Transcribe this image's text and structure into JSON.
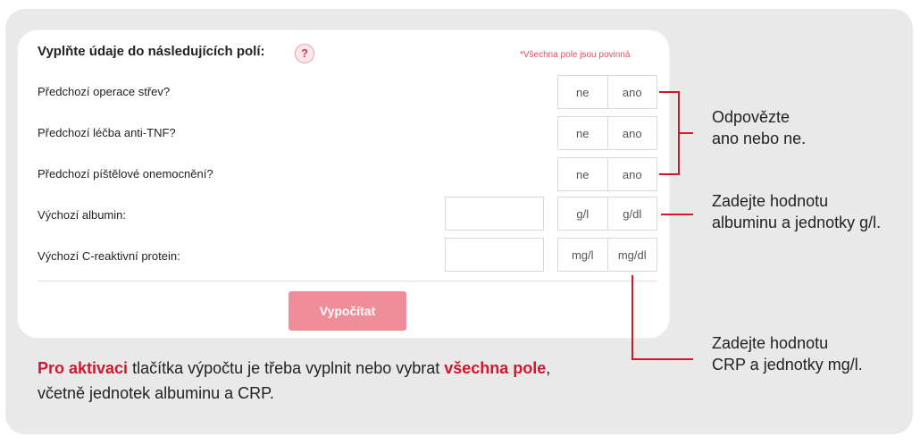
{
  "form": {
    "title": "Vyplňte údaje do následujících polí:",
    "help_glyph": "?",
    "required_note": "*Všechna pole jsou povinná",
    "rows": [
      {
        "label": "Předchozí operace střev?",
        "options": [
          "ne",
          "ano"
        ]
      },
      {
        "label": "Předchozí léčba anti-TNF?",
        "options": [
          "ne",
          "ano"
        ]
      },
      {
        "label": "Předchozí píštělové onemocnění?",
        "options": [
          "ne",
          "ano"
        ]
      },
      {
        "label": "Výchozí albumin:",
        "options": [
          "g/l",
          "g/dl"
        ],
        "value": ""
      },
      {
        "label": "Výchozí C-reaktivní protein:",
        "options": [
          "mg/l",
          "mg/dl"
        ],
        "value": ""
      }
    ],
    "calculate_label": "Vypočítat"
  },
  "annotations": {
    "yes_no_line1": "Odpovězte",
    "yes_no_line2": "ano nebo ne.",
    "albumin_line1": "Zadejte hodnotu",
    "albumin_line2": "albuminu a jednotky g/l.",
    "crp_line1": "Zadejte hodnotu",
    "crp_line2": "CRP a jednotky mg/l."
  },
  "note": {
    "bold1": "Pro aktivaci",
    "text1": " tlačítka výpočtu je třeba vyplnit nebo vybrat ",
    "bold2": "všechna pole",
    "text2": ",",
    "line2": "včetně jednotek albuminu a CRP."
  },
  "colors": {
    "accent": "#d0182c",
    "button": "#ef8d98",
    "panel": "#e9e9ea"
  }
}
